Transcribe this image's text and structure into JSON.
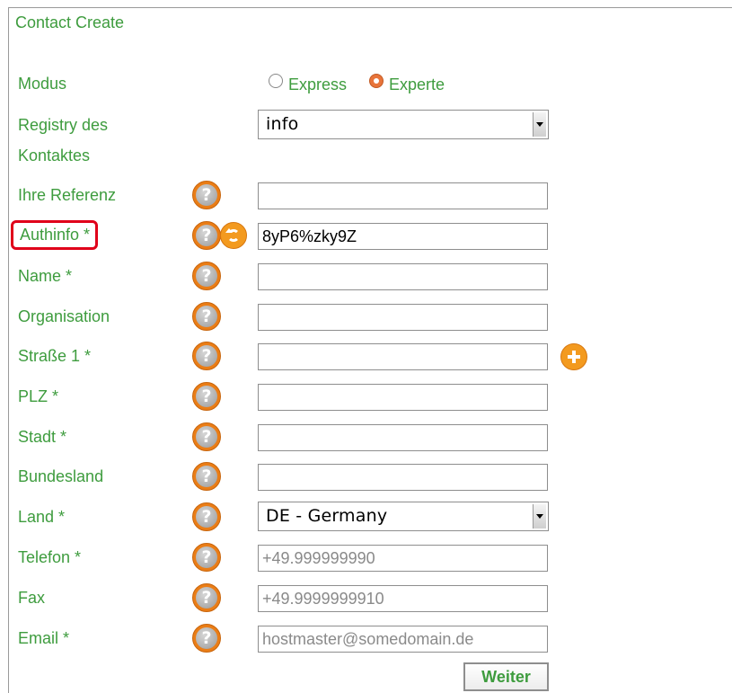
{
  "form": {
    "title": "Contact Create",
    "modus": {
      "label": "Modus",
      "options": [
        {
          "label": "Express",
          "checked": false
        },
        {
          "label": "Experte",
          "checked": true
        }
      ]
    },
    "registry": {
      "label_line1": "Registry des",
      "label_line2": "Kontaktes",
      "value": "info"
    },
    "fields": {
      "referenz": {
        "label": "Ihre Referenz",
        "value": "",
        "placeholder": ""
      },
      "authinfo": {
        "label": "Authinfo *",
        "value": "8yP6%zky9Z"
      },
      "name": {
        "label": "Name *",
        "value": ""
      },
      "organisation": {
        "label": "Organisation",
        "value": ""
      },
      "strasse1": {
        "label": "Straße 1 *",
        "value": ""
      },
      "plz": {
        "label": "PLZ *",
        "value": ""
      },
      "stadt": {
        "label": "Stadt *",
        "value": ""
      },
      "bundesland": {
        "label": "Bundesland",
        "value": ""
      },
      "land": {
        "label": "Land *",
        "value": "DE - Germany"
      },
      "telefon": {
        "label": "Telefon *",
        "placeholder": "+49.999999990"
      },
      "fax": {
        "label": "Fax",
        "placeholder": "+49.9999999910"
      },
      "email": {
        "label": "Email *",
        "placeholder": "hostmaster@somedomain.de"
      }
    },
    "help_glyph": "?",
    "submit_label": "Weiter"
  },
  "icons": {
    "help": "help-icon",
    "refresh": "refresh-icon",
    "add": "add-icon"
  },
  "colors": {
    "label_green": "#3e9c3e",
    "accent_orange": "#f39a1f",
    "highlight_red": "#e0001a"
  }
}
